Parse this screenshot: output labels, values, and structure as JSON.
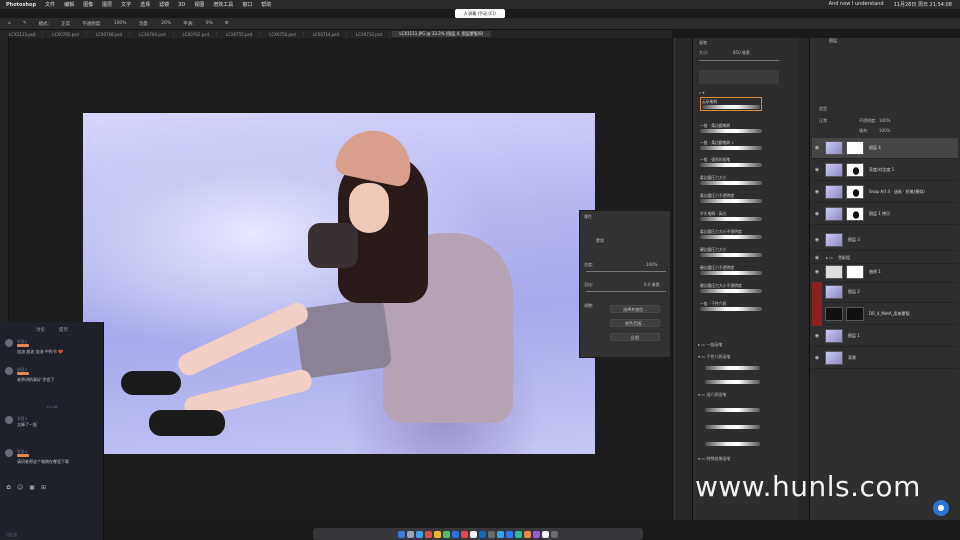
{
  "menubar": {
    "app": "Photoshop",
    "items": [
      "文件",
      "编辑",
      "图像",
      "图层",
      "文字",
      "选择",
      "滤镜",
      "3D",
      "视图",
      "增效工具",
      "窗口",
      "帮助"
    ],
    "status": "And now I understand",
    "datetime": "11月28日 周日 21:54:08"
  },
  "notification": "A 屏幕 (手动 (C))",
  "options": {
    "mode_label": "模式:",
    "mode_value": "正常",
    "opacity_label": "不透明度:",
    "opacity_value": "100%",
    "flow_label": "流量:",
    "flow_value": "20%",
    "smooth_label": "平滑:",
    "smooth_value": "0%"
  },
  "tabs": [
    "LCX1113.psd",
    "LCX0765.psd",
    "LCX0768.psd",
    "LCX0764.psd",
    "LCX0762.psd",
    "LCX0755.psd",
    "LCX0750.psd",
    "LCX0714.psd",
    "LCX0712.psd",
    "LCX1111.JPG @ 33.3% (图层 4, 图层蒙版/8)"
  ],
  "brush_panel": {
    "title": "画笔",
    "size_label": "大小:",
    "size_value": "850 像素",
    "brushes": [
      "云朵笔刷",
      "一般 · 柔边圆笔刷",
      "一般 · 柔边圆笔刷 2",
      "一般 · 强劲的画笔",
      "柔边圆压力大小",
      "柔边圆压力不透明度",
      "平头笔刷 · 高光",
      "柔边圆压力大小不透明度",
      "硬边圆压力大小",
      "硬边圆压力不透明度",
      "硬边圆压力大小不透明度",
      "一般 · 干性介质"
    ],
    "groups": [
      "一般画笔",
      "干性介质画笔",
      "湿介质画笔",
      "特殊效果画笔"
    ]
  },
  "float_panel": {
    "title": "属性",
    "subtitle": "蒙版",
    "density_label": "浓度:",
    "density_value": "100%",
    "feather_label": "羽化:",
    "feather_value": "0.0 像素",
    "refine_label": "调整:",
    "btn_select": "选择并遮住...",
    "btn_color": "颜色范围...",
    "btn_invert": "反相"
  },
  "layers_panel": {
    "title": "图层",
    "kind_label": "类型",
    "blend_mode": "正常",
    "opacity_label": "不透明度:",
    "opacity_value": "100%",
    "fill_label": "填充:",
    "fill_value": "100%",
    "layers": [
      {
        "name": "图层 4",
        "mask": "white",
        "selected": true
      },
      {
        "name": "亮度/对比度 1",
        "mask": "girl"
      },
      {
        "name": "Snap Art 4 · 油画 · 铅笔(模拟)",
        "mask": "girl"
      },
      {
        "name": "图层 1 拷贝",
        "mask": "girl"
      },
      {
        "name": "图层 3",
        "mask": "none"
      },
      {
        "name": "色彩组",
        "mask": "none"
      },
      {
        "name": "曲线 1",
        "mask": "white"
      },
      {
        "name": "图层 2",
        "mask": "none"
      },
      {
        "name": "DR_4_MetA_用来蒙版",
        "mask": "dark"
      },
      {
        "name": "图层 1",
        "mask": "none"
      },
      {
        "name": "背景",
        "mask": "none"
      }
    ]
  },
  "chat": {
    "tab_left": "讨论",
    "tab_right": "提示",
    "messages": [
      {
        "user": "学员1",
        "text": "加油 加油 加油 中秋节 ❤️"
      },
      {
        "user": "学员2",
        "text": "老师讲的真好 学会了"
      },
      {
        "user": "学员3",
        "text": "太棒了一起"
      },
      {
        "user": "学员4",
        "text": "请问老师这个笔刷在哪里下载"
      }
    ],
    "divider": "21:48",
    "footer": "讨论区"
  },
  "watermark": "www.hunls.com",
  "colors": {
    "accent": "#e8864a",
    "layer_red": "#8c2020",
    "fab": "#2a73d9"
  }
}
